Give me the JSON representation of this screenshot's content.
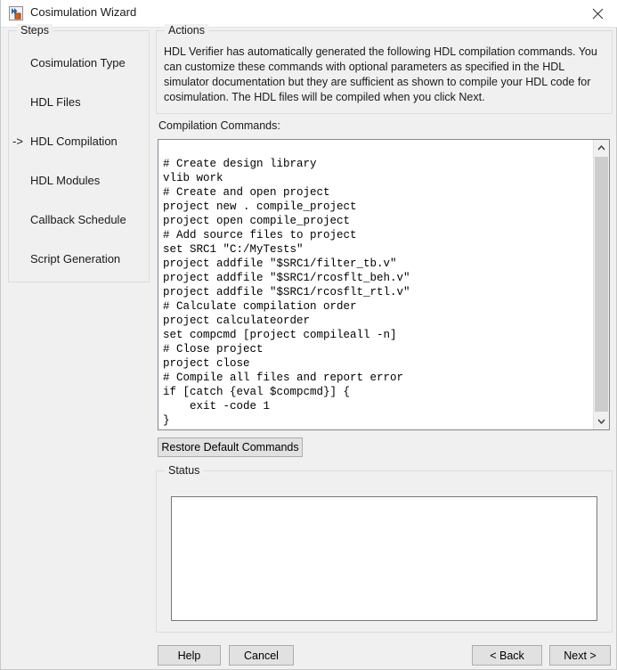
{
  "window": {
    "title": "Cosimulation Wizard",
    "icon": "cosimulation-wizard-icon",
    "close_label": "×"
  },
  "sidebar": {
    "group_label": "Steps",
    "current_arrow": "->",
    "items": [
      {
        "label": "Cosimulation Type",
        "current": false
      },
      {
        "label": "HDL Files",
        "current": false
      },
      {
        "label": "HDL Compilation",
        "current": true
      },
      {
        "label": "HDL Modules",
        "current": false
      },
      {
        "label": "Callback Schedule",
        "current": false
      },
      {
        "label": "Script Generation",
        "current": false
      }
    ]
  },
  "actions": {
    "group_label": "Actions",
    "description": "HDL Verifier has automatically generated the following HDL compilation commands. You can customize these commands with optional parameters as specified in the HDL simulator documentation but they are sufficient as shown to compile your HDL code for cosimulation. The HDL files will be compiled when you click Next."
  },
  "compilation": {
    "label": "Compilation Commands:",
    "commands": "# Create design library\nvlib work\n# Create and open project\nproject new . compile_project\nproject open compile_project\n# Add source files to project\nset SRC1 \"C:/MyTests\"\nproject addfile \"$SRC1/filter_tb.v\"\nproject addfile \"$SRC1/rcosflt_beh.v\"\nproject addfile \"$SRC1/rcosflt_rtl.v\"\n# Calculate compilation order\nproject calculateorder\nset compcmd [project compileall -n]\n# Close project\nproject close\n# Compile all files and report error\nif [catch {eval $compcmd}] {\n    exit -code 1\n}",
    "restore_button": "Restore Default Commands",
    "scrollbar": {
      "up_arrow": "▲",
      "down_arrow": "▼"
    }
  },
  "status": {
    "group_label": "Status",
    "text": ""
  },
  "footer": {
    "help": "Help",
    "cancel": "Cancel",
    "back": "< Back",
    "next": "Next >"
  },
  "colors": {
    "window_background": "#f0f0f0",
    "titlebar_background": "#ffffff",
    "field_background": "#ffffff",
    "button_face": "#e1e1e1",
    "button_border": "#adadad",
    "group_border": "#dcdcdc",
    "field_border": "#828790",
    "scroll_thumb": "#cdcdcd",
    "text": "#000000"
  }
}
